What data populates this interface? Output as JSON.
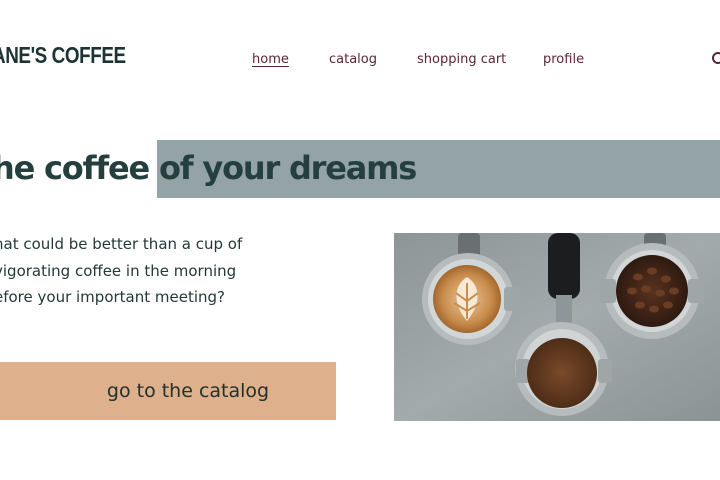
{
  "brand": {
    "logo_text": "ANE'S COFFEE"
  },
  "nav": {
    "items": [
      {
        "label": "home",
        "active": true
      },
      {
        "label": "catalog",
        "active": false
      },
      {
        "label": "shopping cart",
        "active": false
      },
      {
        "label": "profile",
        "active": false
      }
    ]
  },
  "hero": {
    "headline": "he coffee of your dreams",
    "subtitle_lines": [
      "hat could be better than a cup of",
      "vigorating coffee in the morning",
      "efore your important meeting?"
    ],
    "cta_label": "go to the catalog"
  },
  "colors": {
    "accent_band": "#93a3a6",
    "cta_background": "#deb08b",
    "nav_text": "#5a2632",
    "headline_text": "#253f3f"
  }
}
